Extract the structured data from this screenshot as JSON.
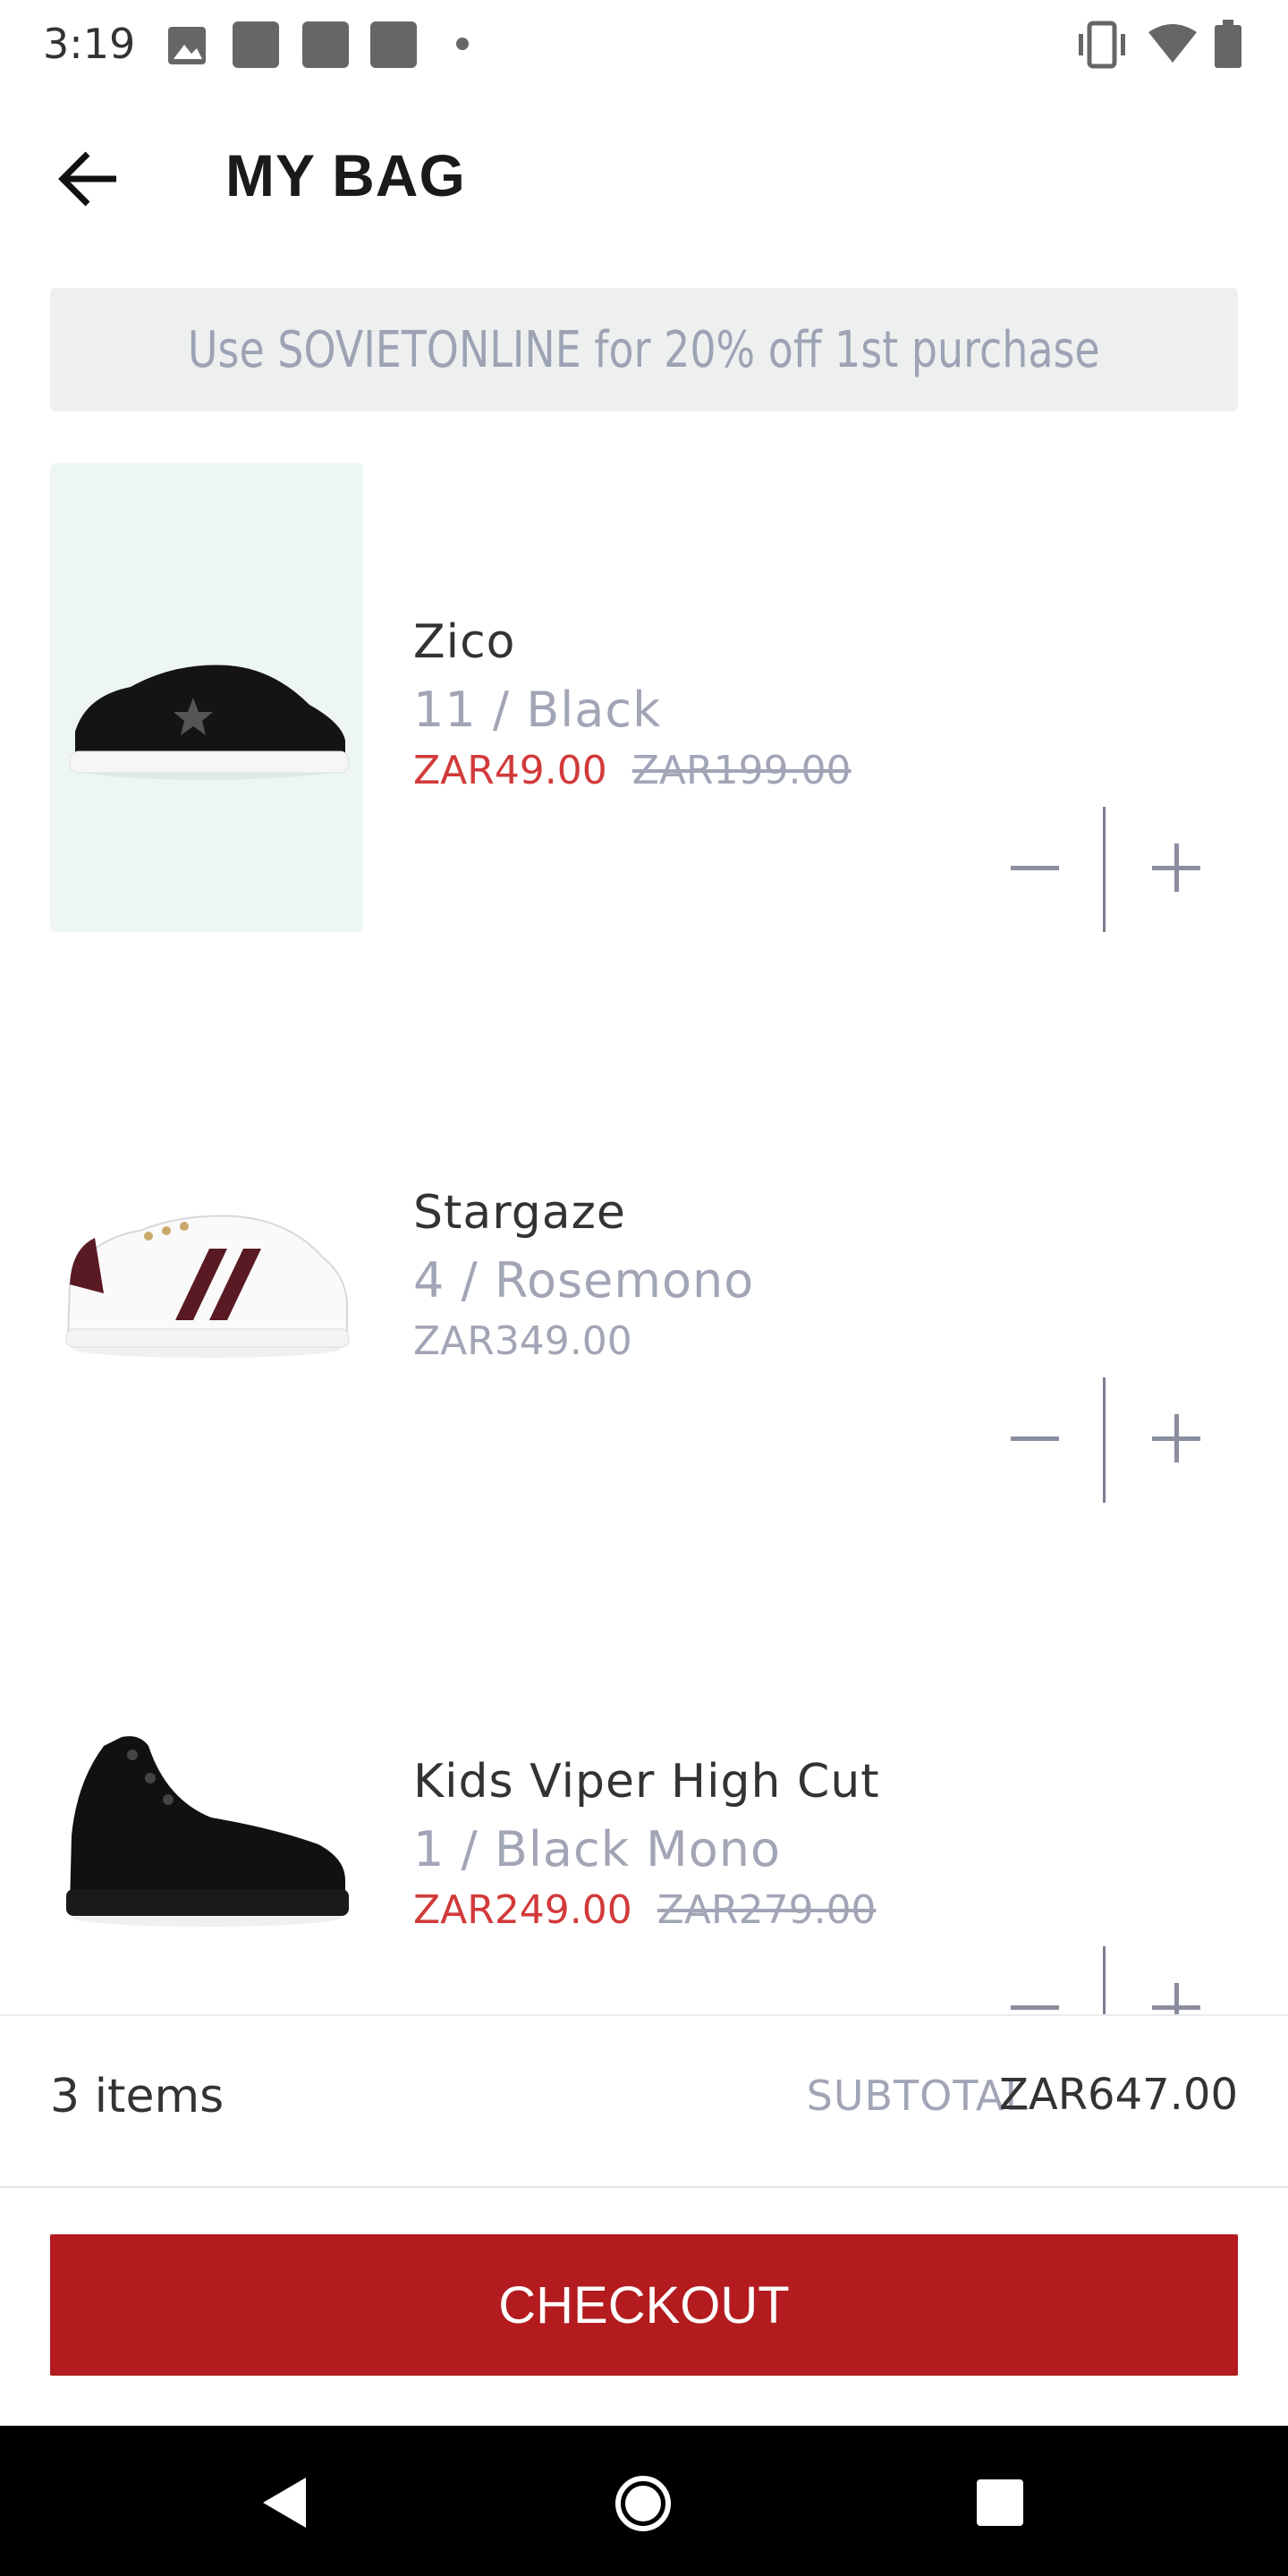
{
  "status_bar": {
    "time": "3:19",
    "icons": [
      "image-icon",
      "notification-square-icon",
      "notification-square-icon",
      "notification-square-icon",
      "dot-icon",
      "vibrate-icon",
      "wifi-icon",
      "battery-icon"
    ]
  },
  "header": {
    "back_icon": "arrow-left-icon",
    "title": "MY BAG"
  },
  "promo": {
    "text": "Use SOVIETONLINE for 20% off 1st purchase"
  },
  "cart": {
    "items": [
      {
        "name": "Zico",
        "variant": "11 / Black",
        "price": "ZAR49.00",
        "original_price": "ZAR199.00",
        "image": "black-sneaker-star"
      },
      {
        "name": "Stargaze",
        "variant": "4 / Rosemono",
        "price": "ZAR349.00",
        "original_price": "",
        "image": "white-sneaker-stripes"
      },
      {
        "name": "Kids Viper High Cut",
        "variant": "1 / Black Mono",
        "price": "ZAR249.00",
        "original_price": "ZAR279.00",
        "image": "black-high-top"
      }
    ],
    "stepper_minus": "−",
    "stepper_plus": "+"
  },
  "summary": {
    "item_count": "3 items",
    "subtotal_label": "SUBTOTAL",
    "subtotal_value": "ZAR647.00"
  },
  "checkout": {
    "label": "CHECKOUT"
  },
  "colors": {
    "accent_red": "#b31b1e",
    "sale_price": "#d23a3a",
    "muted_text": "#a1a5b6",
    "promo_bg": "#eef0f0"
  },
  "nav_bar": {
    "icons": [
      "back-triangle-icon",
      "home-circle-icon",
      "recents-square-icon"
    ]
  }
}
